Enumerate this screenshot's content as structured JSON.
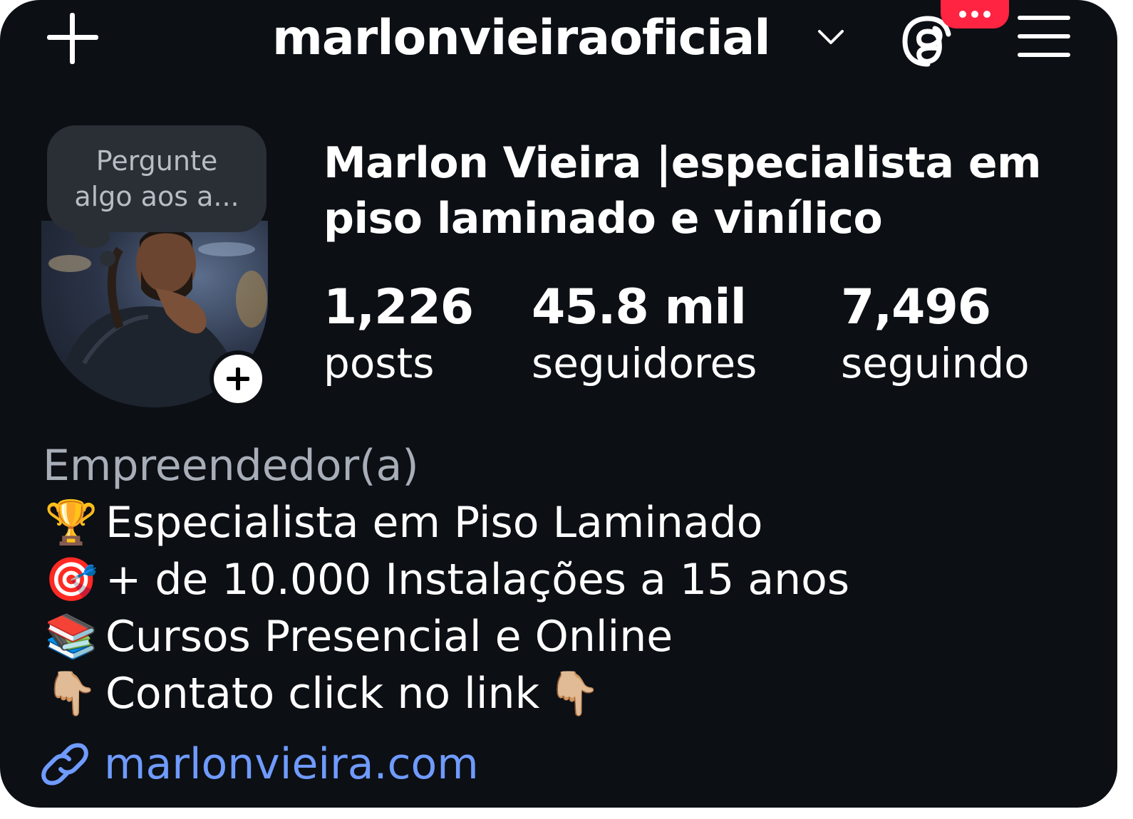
{
  "header": {
    "username": "marlonvieiraoficial",
    "icons": [
      "plus-icon",
      "chevron-down-icon",
      "threads-icon",
      "menu-icon"
    ],
    "notification_badge": "•••",
    "badge_color": "#ff2442"
  },
  "profile": {
    "note": [
      "Pergunte",
      "algo aos a..."
    ],
    "display_name": "Marlon Vieira |especialista em piso laminado e vinílico",
    "stats": [
      {
        "value": "1,226",
        "label": "posts"
      },
      {
        "value": "45.8 mil",
        "label": "seguidores"
      },
      {
        "value": "7,496",
        "label": "seguindo"
      }
    ]
  },
  "bio": {
    "category": "Empreendedor(a)",
    "lines": [
      {
        "emoji": "🏆",
        "text": "Especialista em Piso Laminado"
      },
      {
        "emoji": "🎯",
        "text": "+ de 10.000 Instalações a 15 anos"
      },
      {
        "emoji": "📚",
        "text": "Cursos Presencial e Online"
      },
      {
        "emoji": "👇🏼",
        "text": "Contato click no link",
        "trailing_emoji": "👇🏼"
      }
    ],
    "link": "marlonvieira.com",
    "link_color": "#6f9bff"
  }
}
